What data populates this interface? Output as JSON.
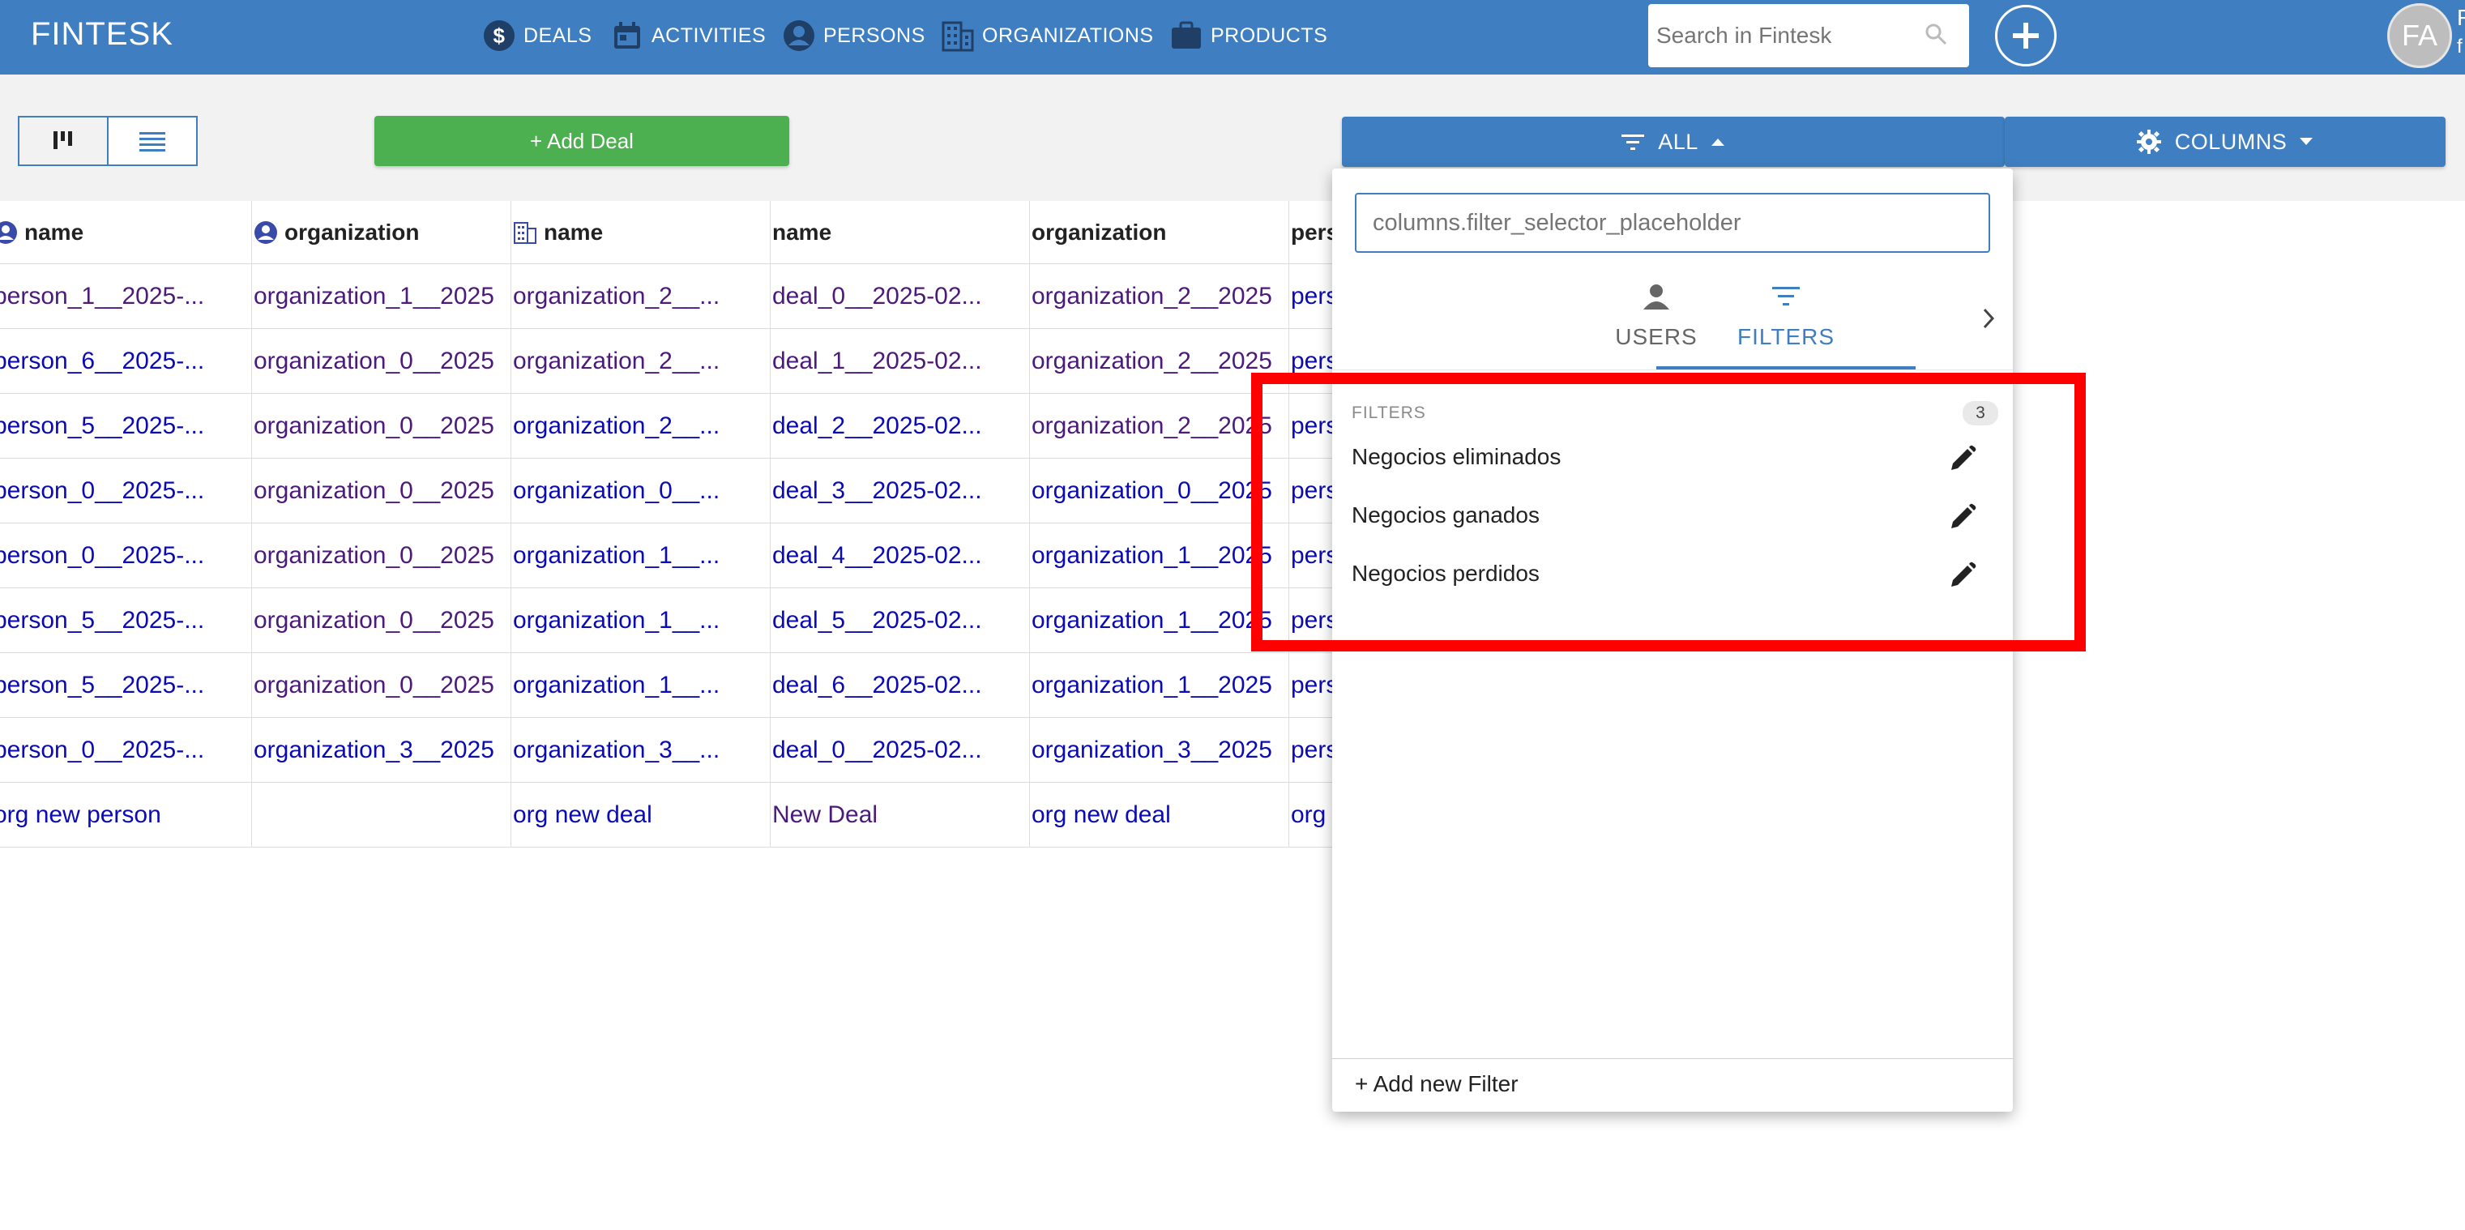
{
  "app": {
    "brand": "FINTESK"
  },
  "nav": [
    {
      "label": "DEALS",
      "icon": "dollar-circle-icon"
    },
    {
      "label": "ACTIVITIES",
      "icon": "calendar-icon"
    },
    {
      "label": "PERSONS",
      "icon": "person-circle-icon"
    },
    {
      "label": "ORGANIZATIONS",
      "icon": "building-icon"
    },
    {
      "label": "PRODUCTS",
      "icon": "briefcase-icon"
    }
  ],
  "search": {
    "placeholder": "Search in Fintesk"
  },
  "user": {
    "initials": "FA",
    "name": "F",
    "sub": "f"
  },
  "toolbar": {
    "add_deal_label": "+ Add Deal",
    "filter_label": "ALL",
    "columns_label": "COLUMNS"
  },
  "table": {
    "columns": [
      {
        "label": "name",
        "icon": "person-circle-icon"
      },
      {
        "label": "organization",
        "icon": "person-circle-icon"
      },
      {
        "label": "name",
        "icon": "building-icon"
      },
      {
        "label": "name",
        "icon": ""
      },
      {
        "label": "organization",
        "icon": ""
      },
      {
        "label": "pers",
        "icon": ""
      }
    ],
    "rows": [
      [
        "person_1__2025-...",
        "organization_1__2025",
        "organization_2__...",
        "deal_0__2025-02...",
        "organization_2__2025",
        "pers"
      ],
      [
        "person_6__2025-...",
        "organization_0__2025",
        "organization_2__...",
        "deal_1__2025-02...",
        "organization_2__2025",
        "pers"
      ],
      [
        "person_5__2025-...",
        "organization_0__2025",
        "organization_2__...",
        "deal_2__2025-02...",
        "organization_2__2025",
        "pers"
      ],
      [
        "person_0__2025-...",
        "organization_0__2025",
        "organization_0__...",
        "deal_3__2025-02...",
        "organization_0__2025",
        "pers"
      ],
      [
        "person_0__2025-...",
        "organization_0__2025",
        "organization_1__...",
        "deal_4__2025-02...",
        "organization_1__2025",
        "pers"
      ],
      [
        "person_5__2025-...",
        "organization_0__2025",
        "organization_1__...",
        "deal_5__2025-02...",
        "organization_1__2025",
        "pers"
      ],
      [
        "person_5__2025-...",
        "organization_0__2025",
        "organization_1__...",
        "deal_6__2025-02...",
        "organization_1__2025",
        "pers"
      ],
      [
        "person_0__2025-...",
        "organization_3__2025",
        "organization_3__...",
        "deal_0__2025-02...",
        "organization_3__2025",
        "pers"
      ],
      [
        "org new person",
        "",
        "org new deal",
        "New Deal",
        "org new deal",
        "org"
      ]
    ]
  },
  "filter_panel": {
    "input_placeholder": "columns.filter_selector_placeholder",
    "tabs": [
      {
        "label": "USERS",
        "icon": "person-icon",
        "active": false
      },
      {
        "label": "FILTERS",
        "icon": "filter-icon",
        "active": true
      }
    ],
    "section_title": "FILTERS",
    "section_count": "3",
    "filters": [
      {
        "label": "Negocios eliminados"
      },
      {
        "label": "Negocios ganados"
      },
      {
        "label": "Negocios perdidos"
      }
    ],
    "add_filter_label": "+ Add new Filter"
  },
  "colors": {
    "primary": "#3f7fc1",
    "add_deal": "#4caf50",
    "highlight": "#ff0000",
    "link": "#0b0bb5",
    "visited_link": "#4b1a7a"
  }
}
